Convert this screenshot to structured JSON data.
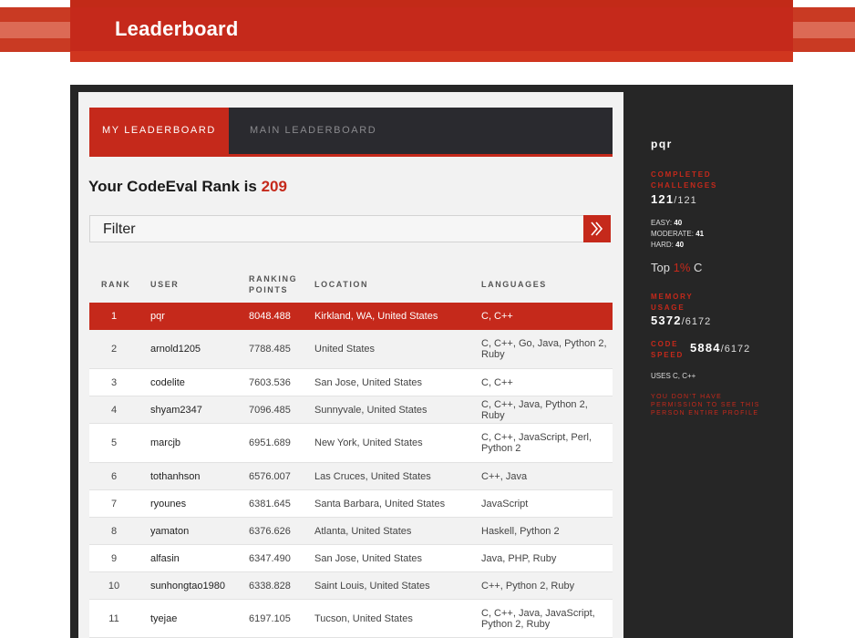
{
  "header": {
    "title": "Leaderboard"
  },
  "tabs": [
    {
      "label": "MY LEADERBOARD",
      "active": true
    },
    {
      "label": "MAIN LEADERBOARD",
      "active": false
    }
  ],
  "rank": {
    "prefix": "Your CodeEval Rank is",
    "value": "209"
  },
  "filter": {
    "label": "Filter",
    "button_icon": "double-chevron-right-icon"
  },
  "table": {
    "headers": {
      "rank": "RANK",
      "user": "USER",
      "points_line1": "RANKING",
      "points_line2": "POINTS",
      "location": "LOCATION",
      "languages": "LANGUAGES"
    },
    "rows": [
      {
        "rank": "1",
        "user": "pqr",
        "points": "8048.488",
        "location": "Kirkland, WA, United States",
        "languages_1": "C, C++",
        "languages_2": ""
      },
      {
        "rank": "2",
        "user": "arnold1205",
        "points": "7788.485",
        "location": "United States",
        "languages_1": "C, C++, Go, Java, Python 2,",
        "languages_2": "Ruby"
      },
      {
        "rank": "3",
        "user": "codelite",
        "points": "7603.536",
        "location": "San Jose, United States",
        "languages_1": "C, C++",
        "languages_2": ""
      },
      {
        "rank": "4",
        "user": "shyam2347",
        "points": "7096.485",
        "location": "Sunnyvale, United States",
        "languages_1": "C, C++, Java, Python 2, Ruby",
        "languages_2": ""
      },
      {
        "rank": "5",
        "user": "marcjb",
        "points": "6951.689",
        "location": "New York, United States",
        "languages_1": "C, C++, JavaScript, Perl,",
        "languages_2": "Python 2"
      },
      {
        "rank": "6",
        "user": "tothanhson",
        "points": "6576.007",
        "location": "Las Cruces, United States",
        "languages_1": "C++, Java",
        "languages_2": ""
      },
      {
        "rank": "7",
        "user": "ryounes",
        "points": "6381.645",
        "location": "Santa Barbara, United States",
        "languages_1": "JavaScript",
        "languages_2": ""
      },
      {
        "rank": "8",
        "user": "yamaton",
        "points": "6376.626",
        "location": "Atlanta, United States",
        "languages_1": "Haskell, Python 2",
        "languages_2": ""
      },
      {
        "rank": "9",
        "user": "alfasin",
        "points": "6347.490",
        "location": "San Jose, United States",
        "languages_1": "Java, PHP, Ruby",
        "languages_2": ""
      },
      {
        "rank": "10",
        "user": "sunhongtao1980",
        "points": "6338.828",
        "location": "Saint Louis, United States",
        "languages_1": "C++, Python 2, Ruby",
        "languages_2": ""
      },
      {
        "rank": "11",
        "user": "tyejae",
        "points": "6197.105",
        "location": "Tucson, United States",
        "languages_1": "C, C++, Java, JavaScript,",
        "languages_2": "Python 2, Ruby"
      }
    ]
  },
  "sidebar": {
    "username": "pqr",
    "completed_label_1": "COMPLETED",
    "completed_label_2": "CHALLENGES",
    "completed_value": "121",
    "completed_total": "/121",
    "easy_label": "EASY:",
    "easy_value": "40",
    "moderate_label": "MODERATE:",
    "moderate_value": "41",
    "hard_label": "HARD:",
    "hard_value": "40",
    "top_prefix": "Top",
    "top_pct": "1%",
    "top_suffix": "C",
    "memory_label_1": "MEMORY",
    "memory_label_2": "USAGE",
    "memory_value": "5372",
    "memory_total": "/6172",
    "speed_label_1": "CODE",
    "speed_label_2": "SPEED",
    "speed_value": "5884",
    "speed_total": "/6172",
    "uses": "USES C, C++",
    "note_1": "YOU DON'T HAVE",
    "note_2": "PERMISSION TO SEE THIS",
    "note_3": "PERSON ENTIRE PROFILE"
  },
  "colors": {
    "accent": "#c5291b",
    "dark": "#262626",
    "tab_bar": "#2a2a2f"
  }
}
